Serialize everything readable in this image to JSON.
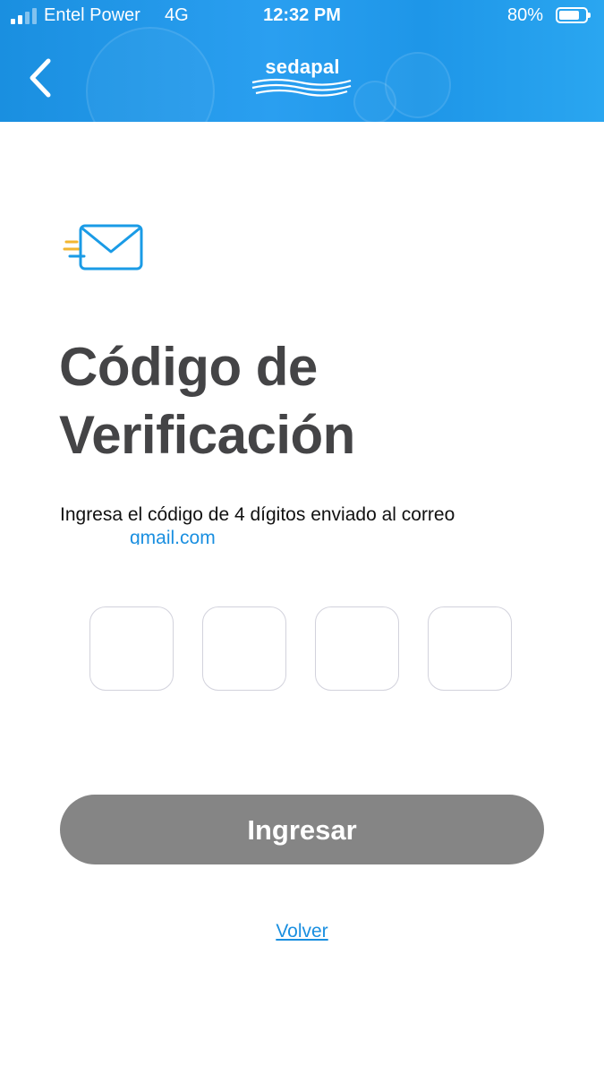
{
  "status_bar": {
    "carrier": "Entel Power",
    "network": "4G",
    "time": "12:32 PM",
    "battery_percent": "80%",
    "battery_level": 0.8,
    "signal_bars": 2,
    "signal_bars_total": 4
  },
  "header": {
    "back_icon": "chevron-left-icon",
    "logo_text": "sedapal"
  },
  "content": {
    "mail_icon": "email-icon",
    "title": "Código de Verificación",
    "instruction": "Ingresa el código de 4 dígitos enviado al correo",
    "email_visible": "gmail.com",
    "code_digits": [
      "",
      "",
      "",
      ""
    ]
  },
  "actions": {
    "submit_label": "Ingresar",
    "back_link_label": "Volver"
  },
  "colors": {
    "header_blue": "#1e96e8",
    "title_gray": "#444446",
    "link_blue": "#1a8fe0",
    "button_gray": "#858585",
    "box_border": "#d2d2dc",
    "mail_icon_blue": "#1a9be6",
    "mail_icon_yellow": "#f2b630"
  }
}
